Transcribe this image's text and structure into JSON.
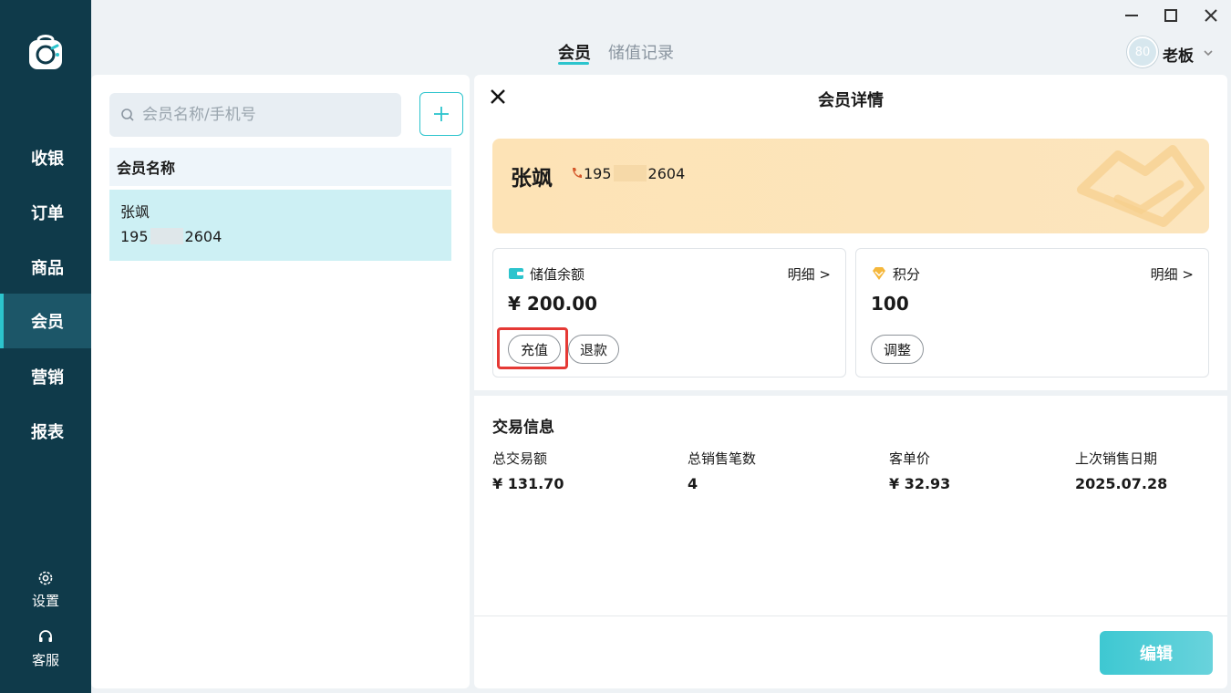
{
  "sidebar": {
    "items": [
      {
        "label": "收银"
      },
      {
        "label": "订单"
      },
      {
        "label": "商品"
      },
      {
        "label": "会员"
      },
      {
        "label": "营销"
      },
      {
        "label": "报表"
      }
    ],
    "active_index": 3,
    "settings_label": "设置",
    "service_label": "客服"
  },
  "topbar": {
    "tabs": [
      {
        "label": "会员"
      },
      {
        "label": "储值记录"
      }
    ],
    "active_tab": 0,
    "avatar_text": "80",
    "user_name": "老板"
  },
  "list": {
    "search_placeholder": "会员名称/手机号",
    "header": "会员名称",
    "members": [
      {
        "name": "张飒",
        "phone_prefix": "195",
        "phone_suffix": "2604"
      }
    ]
  },
  "detail": {
    "title": "会员详情",
    "member_name": "张飒",
    "phone_prefix": "195",
    "phone_suffix": "2604",
    "balance": {
      "title": "储值余额",
      "link": "明细 >",
      "value": "¥ 200.00",
      "recharge_label": "充值",
      "refund_label": "退款"
    },
    "points": {
      "title": "积分",
      "link": "明细 >",
      "value": "100",
      "adjust_label": "调整"
    },
    "trade": {
      "title": "交易信息",
      "items": [
        {
          "label": "总交易额",
          "value": "¥ 131.70"
        },
        {
          "label": "总销售笔数",
          "value": "4"
        },
        {
          "label": "客单价",
          "value": "¥ 32.93"
        },
        {
          "label": "上次销售日期",
          "value": "2025.07.28"
        }
      ]
    },
    "edit_label": "编辑"
  },
  "colors": {
    "sidebar_bg": "#0f3a4a",
    "accent": "#2cc4cd",
    "card_bg": "#fde3b6",
    "highlight": "#e53935"
  }
}
